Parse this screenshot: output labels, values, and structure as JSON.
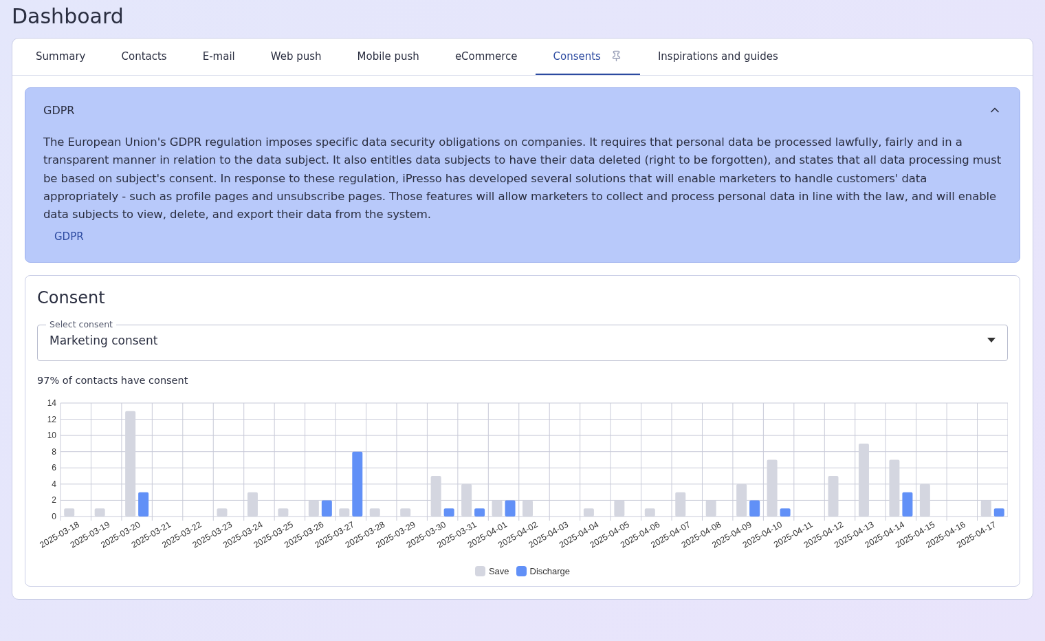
{
  "page_title": "Dashboard",
  "tabs": [
    {
      "label": "Summary",
      "selected": false,
      "pinned": false
    },
    {
      "label": "Contacts",
      "selected": false,
      "pinned": false
    },
    {
      "label": "E-mail",
      "selected": false,
      "pinned": false
    },
    {
      "label": "Web push",
      "selected": false,
      "pinned": false
    },
    {
      "label": "Mobile push",
      "selected": false,
      "pinned": false
    },
    {
      "label": "eCommerce",
      "selected": false,
      "pinned": false
    },
    {
      "label": "Consents",
      "selected": true,
      "pinned": true
    },
    {
      "label": "Inspirations and guides",
      "selected": false,
      "pinned": false
    }
  ],
  "info_panel": {
    "title": "GDPR",
    "expanded": true,
    "text": "The European Union's GDPR regulation imposes specific data security obligations on companies. It requires that personal data be processed lawfully, fairly and in a transparent manner in relation to the data subject. It also entitles data subjects to have their data deleted (right to be forgotten), and states that all data processing must be based on subject's consent. In response to these regulation, iPresso has developed several solutions that will enable marketers to handle customers' data appropriately - such as profile pages and unsubscribe pages. Those features will allow marketers to collect and process personal data in line with the law, and will enable data subjects to view, delete, and export their data from the system.",
    "link": "GDPR"
  },
  "consent_card": {
    "title": "Consent",
    "select": {
      "label": "Select consent",
      "value": "Marketing consent"
    },
    "summary": "97% of contacts have consent",
    "chart_data": {
      "type": "bar",
      "categories": [
        "2025-03-18",
        "2025-03-19",
        "2025-03-20",
        "2025-03-21",
        "2025-03-22",
        "2025-03-23",
        "2025-03-24",
        "2025-03-25",
        "2025-03-26",
        "2025-03-27",
        "2025-03-28",
        "2025-03-29",
        "2025-03-30",
        "2025-03-31",
        "2025-04-01",
        "2025-04-02",
        "2025-04-03",
        "2025-04-04",
        "2025-04-05",
        "2025-04-06",
        "2025-04-07",
        "2025-04-08",
        "2025-04-09",
        "2025-04-10",
        "2025-04-11",
        "2025-04-12",
        "2025-04-13",
        "2025-04-14",
        "2025-04-15",
        "2025-04-16",
        "2025-04-17"
      ],
      "series": [
        {
          "name": "Save",
          "color": "#d4d6e0",
          "values": [
            1,
            1,
            13,
            0,
            0,
            1,
            3,
            1,
            2,
            1,
            1,
            1,
            5,
            4,
            2,
            2,
            0,
            1,
            2,
            1,
            3,
            2,
            4,
            7,
            0,
            5,
            9,
            7,
            4,
            0,
            2
          ]
        },
        {
          "name": "Discharge",
          "color": "#6190f7",
          "values": [
            0,
            0,
            3,
            0,
            0,
            0,
            0,
            0,
            2,
            8,
            0,
            0,
            1,
            1,
            2,
            0,
            0,
            0,
            0,
            0,
            0,
            0,
            2,
            1,
            0,
            0,
            0,
            3,
            0,
            0,
            1
          ]
        }
      ],
      "grid": true,
      "ylim": [
        0,
        14
      ],
      "yticks": [
        0,
        2,
        4,
        6,
        8,
        10,
        12,
        14
      ]
    }
  }
}
